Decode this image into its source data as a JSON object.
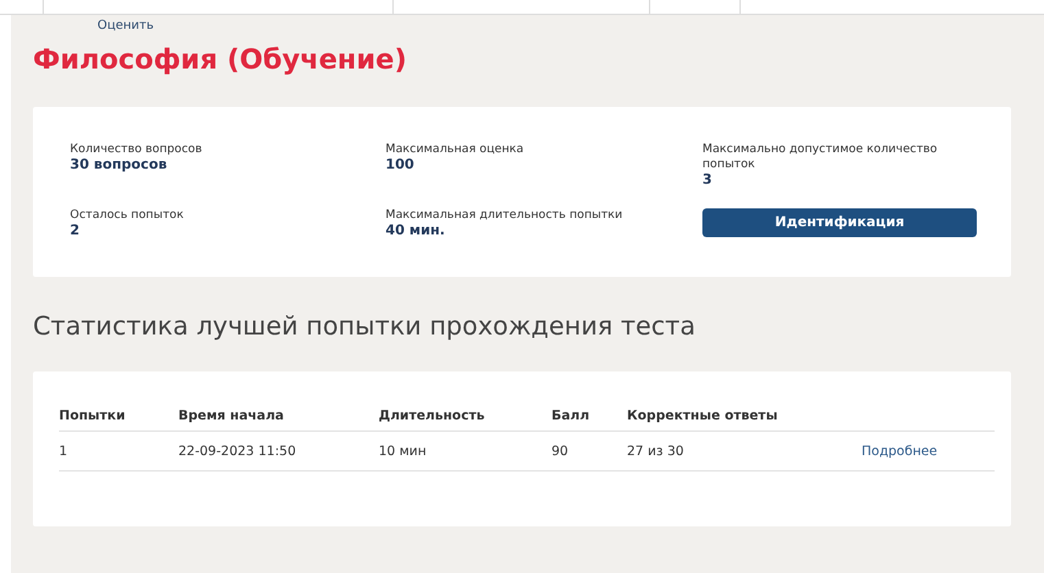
{
  "rate_link": "Оценить",
  "title": "Философия (Обучение)",
  "info": [
    {
      "label": "Количество вопросов",
      "value": "30 вопросов"
    },
    {
      "label": "Максимальная оценка",
      "value": "100"
    },
    {
      "label": "Максимально допустимое количество попыток",
      "value": "3"
    },
    {
      "label": "Осталось попыток",
      "value": "2"
    },
    {
      "label": "Максимальная длительность попытки",
      "value": "40 мин."
    }
  ],
  "identify_button": "Идентификация",
  "stats_heading": "Статистика лучшей попытки прохождения теста",
  "table": {
    "columns": [
      "Попытки",
      "Время начала",
      "Длительность",
      "Балл",
      "Корректные ответы"
    ],
    "rows": [
      {
        "cells": [
          "1",
          "22-09-2023 11:50",
          "10 мин",
          "90",
          "27 из 30"
        ],
        "link": "Подробнее"
      }
    ]
  }
}
